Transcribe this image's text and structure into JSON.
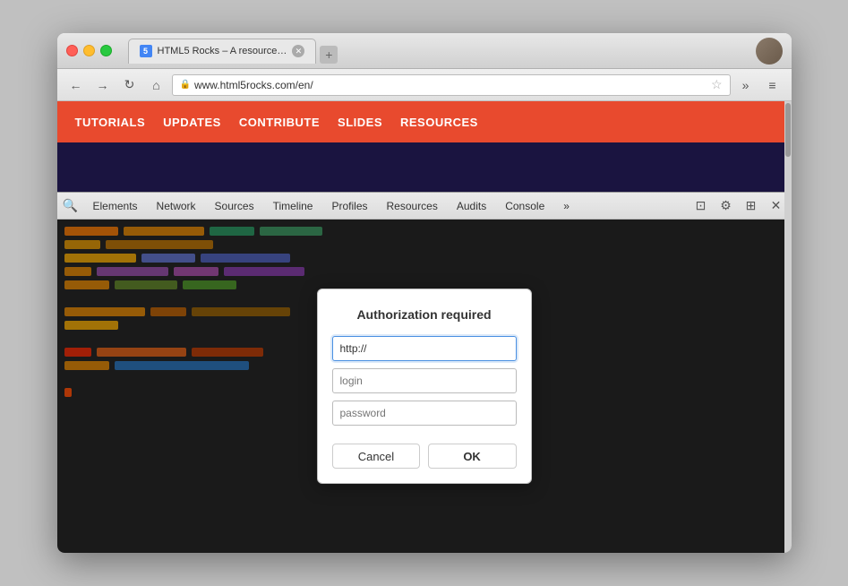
{
  "window": {
    "title": "HTML5 Rocks – A resource…",
    "url": "www.html5rocks.com/en/"
  },
  "tabs": [
    {
      "label": "HTML5 Rocks – A resource…",
      "favicon": "5",
      "active": true
    }
  ],
  "nav": {
    "back_label": "←",
    "forward_label": "→",
    "reload_label": "↻",
    "home_label": "⌂",
    "more_label": "»",
    "menu_label": "≡",
    "star_label": "☆"
  },
  "site": {
    "nav_items": [
      "TUTORIALS",
      "UPDATES",
      "CONTRIBUTE",
      "SLIDES",
      "RESOURCES"
    ]
  },
  "devtools": {
    "tabs": [
      {
        "label": "Elements"
      },
      {
        "label": "Network"
      },
      {
        "label": "Sources"
      },
      {
        "label": "Timeline"
      },
      {
        "label": "Profiles"
      },
      {
        "label": "Resources"
      },
      {
        "label": "Audits"
      },
      {
        "label": "Console"
      }
    ],
    "more_tabs_label": "»",
    "actions": {
      "stack_label": "⊡",
      "settings_label": "⚙",
      "dock_label": "⊞",
      "close_label": "✕"
    }
  },
  "dialog": {
    "title": "Authorization required",
    "url_value": "http://",
    "login_placeholder": "login",
    "password_placeholder": "password",
    "cancel_label": "Cancel",
    "ok_label": "OK"
  }
}
